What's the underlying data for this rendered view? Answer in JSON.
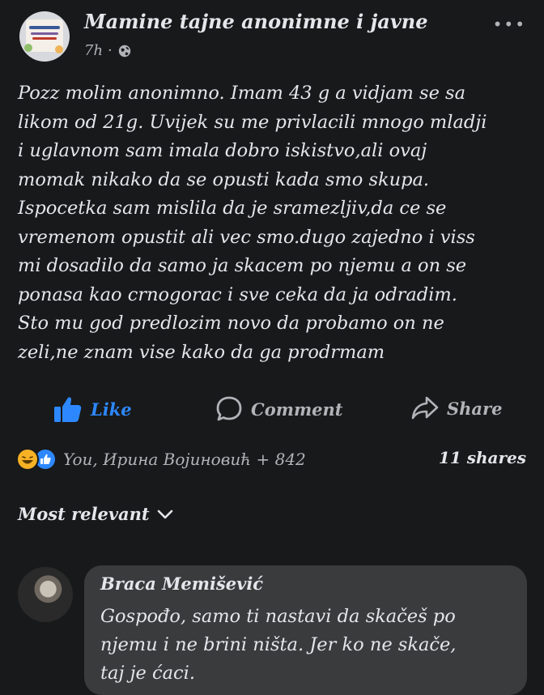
{
  "post": {
    "group_name": "Mamine tajne anonimne i javne",
    "time": "7h",
    "separator": "·",
    "more": "•••",
    "text_lines": [
      "Pozz molim anonimno. Imam 43 g a vidjam se sa",
      "likom od 21g. Uvijek su me privlacili mnogo mladji",
      "i uglavnom sam imala dobro iskistvo,ali ovaj",
      "momak nikako da se opusti kada smo skupa.",
      "Ispocetka sam mislila da je sramezljiv,da ce se",
      "vremenom opustit ali vec smo.dugo zajedno i viss",
      "mi dosadilo da samo ja skacem po njemu a on se",
      "ponasa kao crnogorac i sve ceka da ja odradim.",
      "Sto mu god predlozim novo da probamo on ne",
      "zeli,ne znam vise kako da ga prodrmam"
    ]
  },
  "actions": {
    "like": "Like",
    "comment": "Comment",
    "share": "Share"
  },
  "reactions": {
    "names": "You, Ирина Војиновић + 842",
    "shares": "11 shares"
  },
  "sort": {
    "label": "Most relevant"
  },
  "comment": {
    "author": "Braca Memišević",
    "text_lines": [
      "Gospođo, samo ti nastavi da skačeš po",
      "njemu i ne brini ništa. Jer ko ne skače,",
      "taj je ćaci."
    ]
  },
  "colors": {
    "background": "#18191a",
    "accent_like": "#2d88ff",
    "bubble": "#3a3b3c",
    "secondary_text": "#b0b3b8"
  }
}
